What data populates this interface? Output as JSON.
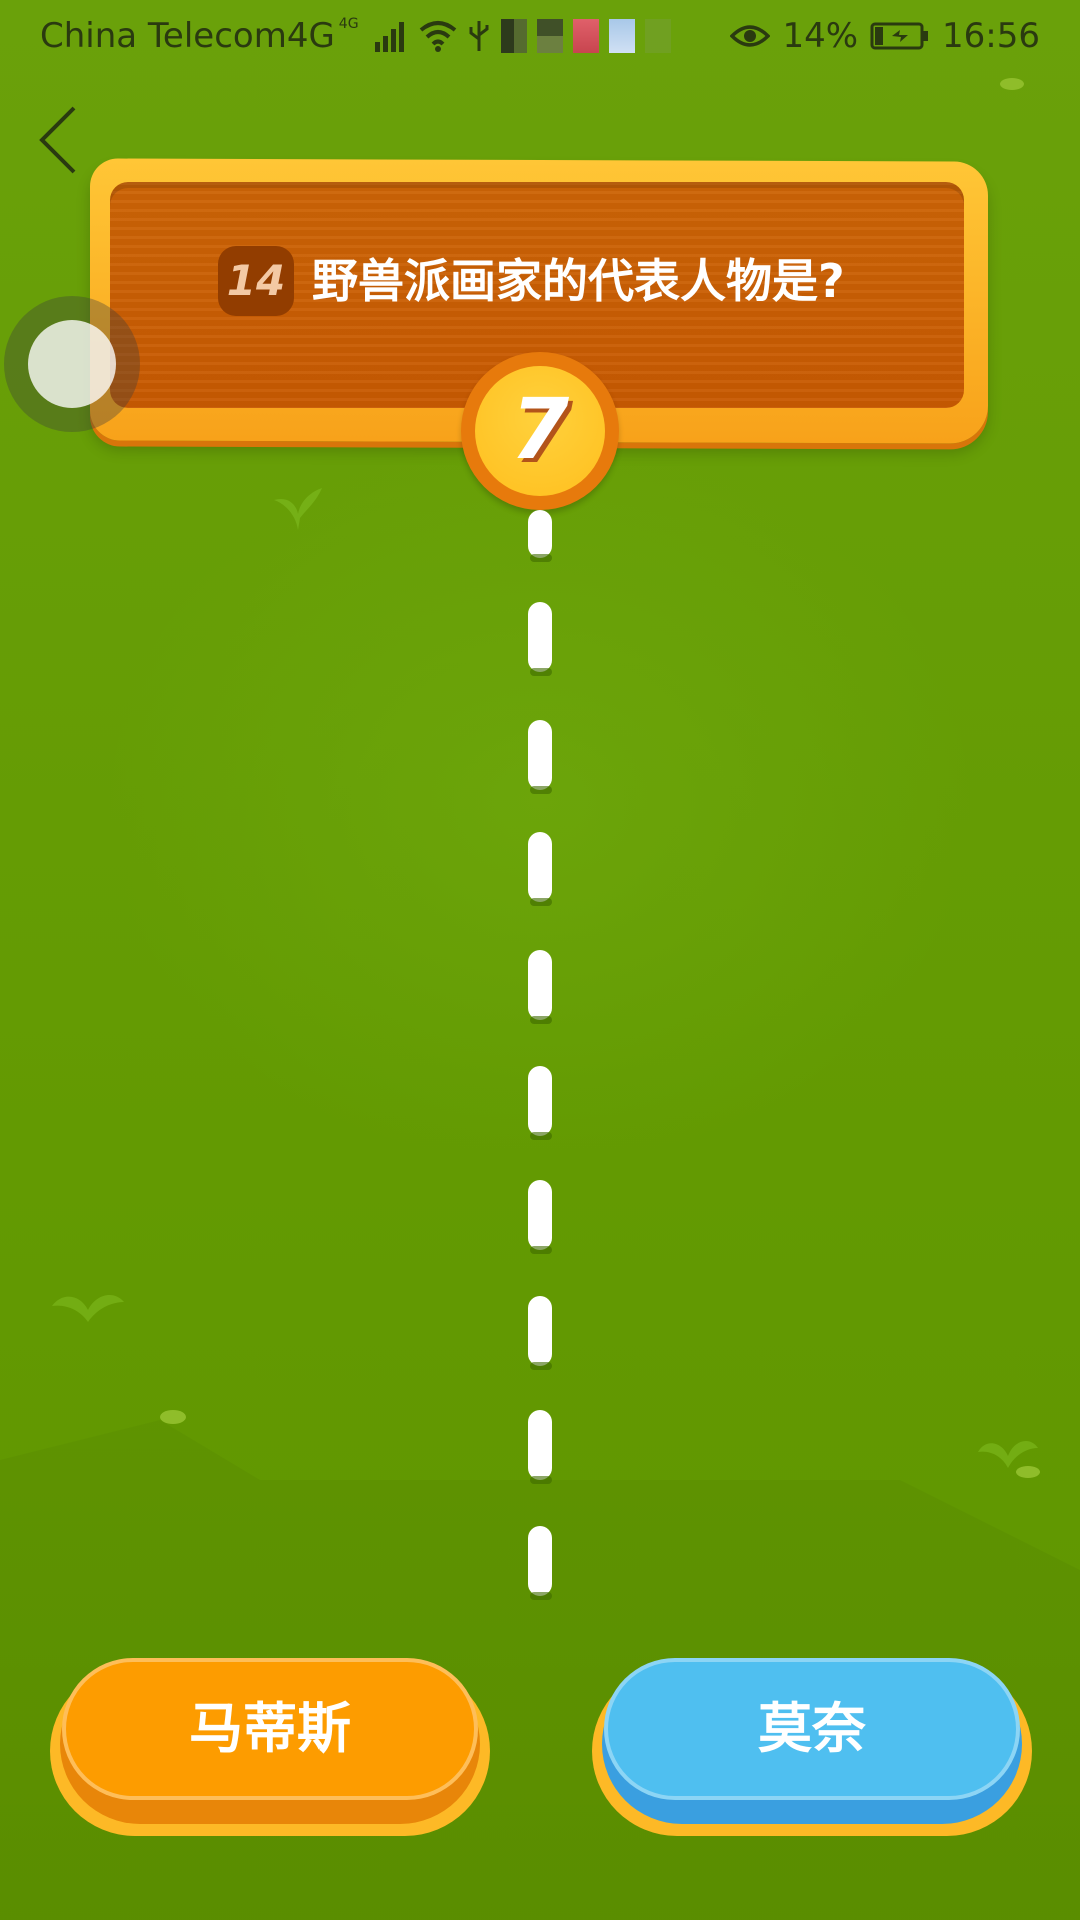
{
  "status_bar": {
    "carrier": "China Telecom4G",
    "network_badge": "4G",
    "battery_percent": "14%",
    "time": "16:56",
    "icons": [
      "signal-icon",
      "wifi-icon",
      "usb-icon",
      "eye-icon",
      "battery-icon"
    ]
  },
  "nav": {
    "back_icon": "chevron-left-icon"
  },
  "question": {
    "number": "14",
    "text": "野兽派画家的代表人物是?"
  },
  "timer": {
    "value": "7"
  },
  "answers": [
    {
      "label": "马蒂斯",
      "color": "#fd9c00"
    },
    {
      "label": "莫奈",
      "color": "#4fbff0"
    }
  ],
  "colors": {
    "background": "#669c03",
    "sign_wood": "#c85a02",
    "sign_frame": "#ffc636",
    "timer": "#ffbf1e"
  }
}
